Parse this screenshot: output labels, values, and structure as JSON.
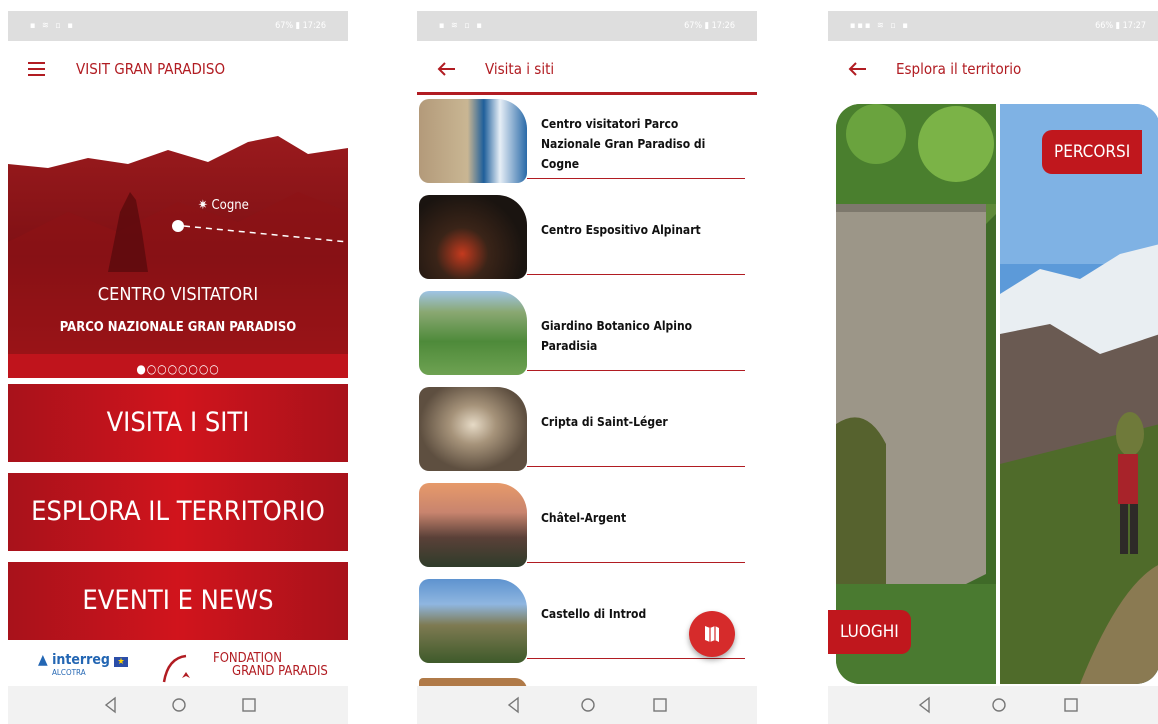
{
  "status": {
    "p1_right": "67% ▮ 17:26",
    "p2_right": "67% ▮ 17:26",
    "p3_right": "66% ▮ 17:27"
  },
  "phone1": {
    "appbar_title": "VISIT GRAN PARADISO",
    "hero_place": "Cogne",
    "hero_title": "CENTRO VISITATORI",
    "hero_subtitle": "PARCO NAZIONALE GRAN PARADISO",
    "dots": "●○○○○○○○",
    "menu": [
      "VISITA I SITI",
      "ESPLORA IL TERRITORIO",
      "EVENTI E NEWS"
    ],
    "footer": {
      "interreg": "interreg",
      "alcotra": "ALCOTRA",
      "fondation_1": "FONDATION",
      "fondation_2": "GRAND PARADIS"
    }
  },
  "phone2": {
    "appbar_title": "Visita i siti",
    "sites": [
      "Centro visitatori Parco Nazionale Gran Paradiso di Cogne",
      "Centro Espositivo Alpinart",
      "Giardino Botanico Alpino Paradisia",
      "Cripta di Saint-Léger",
      "Châtel-Argent",
      "Castello di Introd"
    ]
  },
  "phone3": {
    "appbar_title": "Esplora il territorio",
    "chip_right": "PERCORSI",
    "chip_left": "LUOGHI"
  },
  "colors": {
    "brand_red": "#b11c22",
    "button_red": "#c8141c",
    "fab_red": "#d62b2b"
  }
}
